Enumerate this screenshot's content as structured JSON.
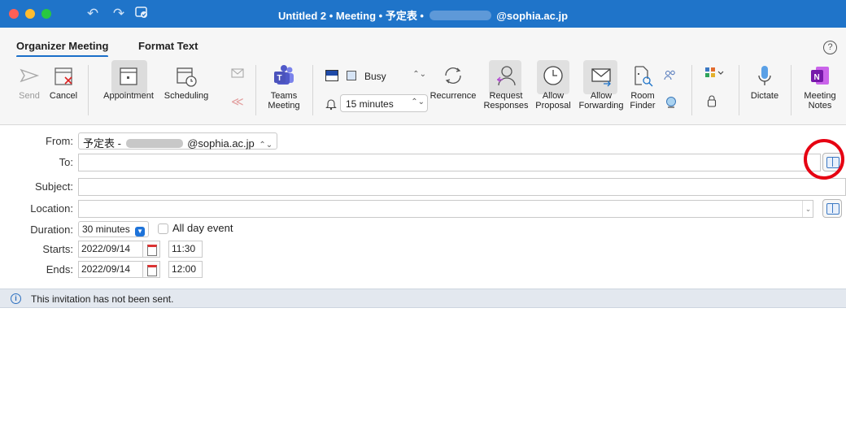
{
  "window": {
    "title_prefix": "Untitled 2 • Meeting • 予定表 •",
    "title_suffix": "@sophia.ac.jp",
    "title_bar_color": "#1f74c9"
  },
  "tabs": [
    {
      "label": "Organizer Meeting",
      "active": true
    },
    {
      "label": "Format Text",
      "active": false
    }
  ],
  "help": {
    "glyph": "?"
  },
  "ribbon": {
    "send": "Send",
    "cancel": "Cancel",
    "appointment": "Appointment",
    "scheduling": "Scheduling",
    "teams_line1": "Teams",
    "teams_line2": "Meeting",
    "show_as": "Busy",
    "reminder": "15 minutes",
    "recurrence": "Recurrence",
    "request_line1": "Request",
    "request_line2": "Responses",
    "allow_proposal_line1": "Allow",
    "allow_proposal_line2": "Proposal",
    "allow_forwarding_line1": "Allow",
    "allow_forwarding_line2": "Forwarding",
    "room_finder_line1": "Room",
    "room_finder_line2": "Finder",
    "dictate": "Dictate",
    "meeting_notes_line1": "Meeting",
    "meeting_notes_line2": "Notes"
  },
  "form": {
    "from_label": "From:",
    "from_prefix": "予定表 -",
    "from_suffix": "@sophia.ac.jp",
    "to_label": "To:",
    "to_value": "",
    "subject_label": "Subject:",
    "subject_value": "",
    "location_label": "Location:",
    "location_value": "",
    "duration_label": "Duration:",
    "duration_value": "30 minutes",
    "all_day_label": "All day event",
    "all_day_checked": false,
    "starts_label": "Starts:",
    "starts_date": "2022/09/14",
    "starts_time": "11:30",
    "ends_label": "Ends:",
    "ends_date": "2022/09/14",
    "ends_time": "12:00"
  },
  "info_bar": {
    "icon": "info-icon",
    "text": "This invitation has not been sent."
  },
  "highlight": {
    "color": "#e60012",
    "target": "to-address-book-button"
  }
}
